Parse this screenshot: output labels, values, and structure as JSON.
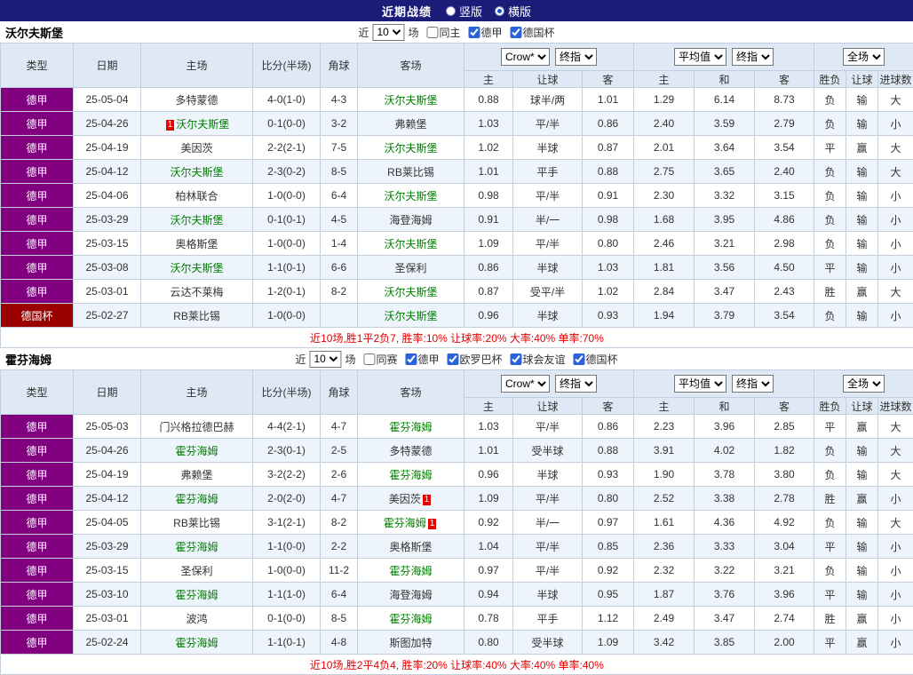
{
  "topbar": {
    "title": "近期战绩",
    "radios": [
      {
        "label": "竖版",
        "selected": false
      },
      {
        "label": "横版",
        "selected": true
      }
    ]
  },
  "colors": {
    "topbar_bg": "#1b1c77",
    "league_bg": "#800080",
    "cup_bg": "#9a0000",
    "header_bg": "#dfe9f5",
    "alt_row_bg": "#eef4fb",
    "red": "#e60000",
    "green": "#008800",
    "blue": "#0013c0",
    "focus_team_green": "#008000"
  },
  "sections": [
    {
      "team": "沃尔夫斯堡",
      "filter": {
        "prefix": "近",
        "count": "10",
        "suffix": "场",
        "checkboxes": [
          {
            "label": "同主",
            "checked": false
          },
          {
            "label": "德甲",
            "checked": true
          },
          {
            "label": "德国杯",
            "checked": true
          }
        ]
      },
      "header": {
        "static_cols": [
          "类型",
          "日期",
          "主场",
          "比分(半场)",
          "角球",
          "客场"
        ],
        "group1_selects": [
          "Crow*",
          "终指"
        ],
        "group1_cols": [
          "主",
          "让球",
          "客"
        ],
        "group2_selects": [
          "平均值",
          "终指"
        ],
        "group2_cols": [
          "主",
          "和",
          "客"
        ],
        "group3_selects": [
          "全场"
        ],
        "group3_cols": [
          "胜负",
          "让球",
          "进球数"
        ]
      },
      "rows": [
        {
          "type": "德甲",
          "cup": false,
          "date": "25-05-04",
          "home": "多特蒙德",
          "home_focus": false,
          "home_badge": false,
          "score": "4-0(1-0)",
          "corners": "4-3",
          "away": "沃尔夫斯堡",
          "away_focus": true,
          "away_badge": false,
          "odds": [
            "0.88",
            "球半/两",
            "1.01"
          ],
          "avg": [
            "1.29",
            "6.14",
            "8.73"
          ],
          "wdl": [
            "负",
            "r"
          ],
          "cover": [
            "输",
            "b"
          ],
          "goals": [
            "大",
            "r"
          ]
        },
        {
          "type": "德甲",
          "cup": false,
          "date": "25-04-26",
          "home": "沃尔夫斯堡",
          "home_focus": true,
          "home_badge": true,
          "score": "0-1(0-0)",
          "corners": "3-2",
          "away": "弗赖堡",
          "away_focus": false,
          "away_badge": false,
          "odds": [
            "1.03",
            "平/半",
            "0.86"
          ],
          "avg": [
            "2.40",
            "3.59",
            "2.79"
          ],
          "wdl": [
            "负",
            "r"
          ],
          "cover": [
            "输",
            "b"
          ],
          "goals": [
            "小",
            "g"
          ]
        },
        {
          "type": "德甲",
          "cup": false,
          "date": "25-04-19",
          "home": "美因茨",
          "home_focus": false,
          "home_badge": false,
          "score": "2-2(2-1)",
          "corners": "7-5",
          "away": "沃尔夫斯堡",
          "away_focus": true,
          "away_badge": false,
          "odds": [
            "1.02",
            "半球",
            "0.87"
          ],
          "avg": [
            "2.01",
            "3.64",
            "3.54"
          ],
          "wdl": [
            "平",
            "g"
          ],
          "cover": [
            "赢",
            "r"
          ],
          "goals": [
            "大",
            "r"
          ]
        },
        {
          "type": "德甲",
          "cup": false,
          "date": "25-04-12",
          "home": "沃尔夫斯堡",
          "home_focus": true,
          "home_badge": false,
          "score": "2-3(0-2)",
          "corners": "8-5",
          "away": "RB莱比锡",
          "away_focus": false,
          "away_badge": false,
          "odds": [
            "1.01",
            "平手",
            "0.88"
          ],
          "avg": [
            "2.75",
            "3.65",
            "2.40"
          ],
          "wdl": [
            "负",
            "r"
          ],
          "cover": [
            "输",
            "b"
          ],
          "goals": [
            "大",
            "r"
          ]
        },
        {
          "type": "德甲",
          "cup": false,
          "date": "25-04-06",
          "home": "柏林联合",
          "home_focus": false,
          "home_badge": false,
          "score": "1-0(0-0)",
          "corners": "6-4",
          "away": "沃尔夫斯堡",
          "away_focus": true,
          "away_badge": false,
          "odds": [
            "0.98",
            "平/半",
            "0.91"
          ],
          "avg": [
            "2.30",
            "3.32",
            "3.15"
          ],
          "wdl": [
            "负",
            "r"
          ],
          "cover": [
            "输",
            "b"
          ],
          "goals": [
            "小",
            "g"
          ]
        },
        {
          "type": "德甲",
          "cup": false,
          "date": "25-03-29",
          "home": "沃尔夫斯堡",
          "home_focus": true,
          "home_badge": false,
          "score": "0-1(0-1)",
          "corners": "4-5",
          "away": "海登海姆",
          "away_focus": false,
          "away_badge": false,
          "odds": [
            "0.91",
            "半/一",
            "0.98"
          ],
          "avg": [
            "1.68",
            "3.95",
            "4.86"
          ],
          "wdl": [
            "负",
            "r"
          ],
          "cover": [
            "输",
            "b"
          ],
          "goals": [
            "小",
            "g"
          ]
        },
        {
          "type": "德甲",
          "cup": false,
          "date": "25-03-15",
          "home": "奥格斯堡",
          "home_focus": false,
          "home_badge": false,
          "score": "1-0(0-0)",
          "corners": "1-4",
          "away": "沃尔夫斯堡",
          "away_focus": true,
          "away_badge": false,
          "odds": [
            "1.09",
            "平/半",
            "0.80"
          ],
          "avg": [
            "2.46",
            "3.21",
            "2.98"
          ],
          "wdl": [
            "负",
            "r"
          ],
          "cover": [
            "输",
            "b"
          ],
          "goals": [
            "小",
            "g"
          ]
        },
        {
          "type": "德甲",
          "cup": false,
          "date": "25-03-08",
          "home": "沃尔夫斯堡",
          "home_focus": true,
          "home_badge": false,
          "score": "1-1(0-1)",
          "corners": "6-6",
          "away": "圣保利",
          "away_focus": false,
          "away_badge": false,
          "odds": [
            "0.86",
            "半球",
            "1.03"
          ],
          "avg": [
            "1.81",
            "3.56",
            "4.50"
          ],
          "wdl": [
            "平",
            "g"
          ],
          "cover": [
            "输",
            "b"
          ],
          "goals": [
            "小",
            "g"
          ]
        },
        {
          "type": "德甲",
          "cup": false,
          "date": "25-03-01",
          "home": "云达不莱梅",
          "home_focus": false,
          "home_badge": false,
          "score": "1-2(0-1)",
          "corners": "8-2",
          "away": "沃尔夫斯堡",
          "away_focus": true,
          "away_badge": false,
          "odds": [
            "0.87",
            "受平/半",
            "1.02"
          ],
          "avg": [
            "2.84",
            "3.47",
            "2.43"
          ],
          "wdl": [
            "胜",
            "r"
          ],
          "cover": [
            "赢",
            "r"
          ],
          "goals": [
            "大",
            "r"
          ]
        },
        {
          "type": "德国杯",
          "cup": true,
          "date": "25-02-27",
          "home": "RB莱比锡",
          "home_focus": false,
          "home_badge": false,
          "score": "1-0(0-0)",
          "corners": "",
          "away": "沃尔夫斯堡",
          "away_focus": true,
          "away_badge": false,
          "odds": [
            "0.96",
            "半球",
            "0.93"
          ],
          "avg": [
            "1.94",
            "3.79",
            "3.54"
          ],
          "wdl": [
            "负",
            "r"
          ],
          "cover": [
            "输",
            "b"
          ],
          "goals": [
            "小",
            "g"
          ]
        }
      ],
      "summary": "近10场,胜1平2负7, 胜率:10% 让球率:20% 大率:40% 单率:70%"
    },
    {
      "team": "霍芬海姆",
      "filter": {
        "prefix": "近",
        "count": "10",
        "suffix": "场",
        "checkboxes": [
          {
            "label": "同赛",
            "checked": false
          },
          {
            "label": "德甲",
            "checked": true
          },
          {
            "label": "欧罗巴杯",
            "checked": true
          },
          {
            "label": "球会友谊",
            "checked": true
          },
          {
            "label": "德国杯",
            "checked": true
          }
        ]
      },
      "header": {
        "static_cols": [
          "类型",
          "日期",
          "主场",
          "比分(半场)",
          "角球",
          "客场"
        ],
        "group1_selects": [
          "Crow*",
          "终指"
        ],
        "group1_cols": [
          "主",
          "让球",
          "客"
        ],
        "group2_selects": [
          "平均值",
          "终指"
        ],
        "group2_cols": [
          "主",
          "和",
          "客"
        ],
        "group3_selects": [
          "全场"
        ],
        "group3_cols": [
          "胜负",
          "让球",
          "进球数"
        ]
      },
      "rows": [
        {
          "type": "德甲",
          "cup": false,
          "date": "25-05-03",
          "home": "门兴格拉德巴赫",
          "home_focus": false,
          "home_badge": false,
          "score": "4-4(2-1)",
          "corners": "4-7",
          "away": "霍芬海姆",
          "away_focus": true,
          "away_badge": false,
          "odds": [
            "1.03",
            "平/半",
            "0.86"
          ],
          "avg": [
            "2.23",
            "3.96",
            "2.85"
          ],
          "wdl": [
            "平",
            "g"
          ],
          "cover": [
            "赢",
            "r"
          ],
          "goals": [
            "大",
            "r"
          ]
        },
        {
          "type": "德甲",
          "cup": false,
          "date": "25-04-26",
          "home": "霍芬海姆",
          "home_focus": true,
          "home_badge": false,
          "score": "2-3(0-1)",
          "corners": "2-5",
          "away": "多特蒙德",
          "away_focus": false,
          "away_badge": false,
          "odds": [
            "1.01",
            "受半球",
            "0.88"
          ],
          "avg": [
            "3.91",
            "4.02",
            "1.82"
          ],
          "wdl": [
            "负",
            "r"
          ],
          "cover": [
            "输",
            "b"
          ],
          "goals": [
            "大",
            "r"
          ]
        },
        {
          "type": "德甲",
          "cup": false,
          "date": "25-04-19",
          "home": "弗赖堡",
          "home_focus": false,
          "home_badge": false,
          "score": "3-2(2-2)",
          "corners": "2-6",
          "away": "霍芬海姆",
          "away_focus": true,
          "away_badge": false,
          "odds": [
            "0.96",
            "半球",
            "0.93"
          ],
          "avg": [
            "1.90",
            "3.78",
            "3.80"
          ],
          "wdl": [
            "负",
            "r"
          ],
          "cover": [
            "输",
            "b"
          ],
          "goals": [
            "大",
            "r"
          ]
        },
        {
          "type": "德甲",
          "cup": false,
          "date": "25-04-12",
          "home": "霍芬海姆",
          "home_focus": true,
          "home_badge": false,
          "score": "2-0(2-0)",
          "corners": "4-7",
          "away": "美因茨",
          "away_focus": false,
          "away_badge": true,
          "odds": [
            "1.09",
            "平/半",
            "0.80"
          ],
          "avg": [
            "2.52",
            "3.38",
            "2.78"
          ],
          "wdl": [
            "胜",
            "r"
          ],
          "cover": [
            "赢",
            "r"
          ],
          "goals": [
            "小",
            "g"
          ]
        },
        {
          "type": "德甲",
          "cup": false,
          "date": "25-04-05",
          "home": "RB莱比锡",
          "home_focus": false,
          "home_badge": false,
          "score": "3-1(2-1)",
          "corners": "8-2",
          "away": "霍芬海姆",
          "away_focus": true,
          "away_badge": true,
          "odds": [
            "0.92",
            "半/一",
            "0.97"
          ],
          "avg": [
            "1.61",
            "4.36",
            "4.92"
          ],
          "wdl": [
            "负",
            "r"
          ],
          "cover": [
            "输",
            "b"
          ],
          "goals": [
            "大",
            "r"
          ]
        },
        {
          "type": "德甲",
          "cup": false,
          "date": "25-03-29",
          "home": "霍芬海姆",
          "home_focus": true,
          "home_badge": false,
          "score": "1-1(0-0)",
          "corners": "2-2",
          "away": "奥格斯堡",
          "away_focus": false,
          "away_badge": false,
          "odds": [
            "1.04",
            "平/半",
            "0.85"
          ],
          "avg": [
            "2.36",
            "3.33",
            "3.04"
          ],
          "wdl": [
            "平",
            "g"
          ],
          "cover": [
            "输",
            "b"
          ],
          "goals": [
            "小",
            "g"
          ]
        },
        {
          "type": "德甲",
          "cup": false,
          "date": "25-03-15",
          "home": "圣保利",
          "home_focus": false,
          "home_badge": false,
          "score": "1-0(0-0)",
          "corners": "11-2",
          "away": "霍芬海姆",
          "away_focus": true,
          "away_badge": false,
          "odds": [
            "0.97",
            "平/半",
            "0.92"
          ],
          "avg": [
            "2.32",
            "3.22",
            "3.21"
          ],
          "wdl": [
            "负",
            "r"
          ],
          "cover": [
            "输",
            "b"
          ],
          "goals": [
            "小",
            "g"
          ]
        },
        {
          "type": "德甲",
          "cup": false,
          "date": "25-03-10",
          "home": "霍芬海姆",
          "home_focus": true,
          "home_badge": false,
          "score": "1-1(1-0)",
          "corners": "6-4",
          "away": "海登海姆",
          "away_focus": false,
          "away_badge": false,
          "odds": [
            "0.94",
            "半球",
            "0.95"
          ],
          "avg": [
            "1.87",
            "3.76",
            "3.96"
          ],
          "wdl": [
            "平",
            "g"
          ],
          "cover": [
            "输",
            "b"
          ],
          "goals": [
            "小",
            "g"
          ]
        },
        {
          "type": "德甲",
          "cup": false,
          "date": "25-03-01",
          "home": "波鸿",
          "home_focus": false,
          "home_badge": false,
          "score": "0-1(0-0)",
          "corners": "8-5",
          "away": "霍芬海姆",
          "away_focus": true,
          "away_badge": false,
          "odds": [
            "0.78",
            "平手",
            "1.12"
          ],
          "avg": [
            "2.49",
            "3.47",
            "2.74"
          ],
          "wdl": [
            "胜",
            "r"
          ],
          "cover": [
            "赢",
            "r"
          ],
          "goals": [
            "小",
            "g"
          ]
        },
        {
          "type": "德甲",
          "cup": false,
          "date": "25-02-24",
          "home": "霍芬海姆",
          "home_focus": true,
          "home_badge": false,
          "score": "1-1(0-1)",
          "corners": "4-8",
          "away": "斯图加特",
          "away_focus": false,
          "away_badge": false,
          "odds": [
            "0.80",
            "受半球",
            "1.09"
          ],
          "avg": [
            "3.42",
            "3.85",
            "2.00"
          ],
          "wdl": [
            "平",
            "g"
          ],
          "cover": [
            "赢",
            "r"
          ],
          "goals": [
            "小",
            "g"
          ]
        }
      ],
      "summary": "近10场,胜2平4负4, 胜率:20% 让球率:40% 大率:40% 单率:40%"
    }
  ]
}
